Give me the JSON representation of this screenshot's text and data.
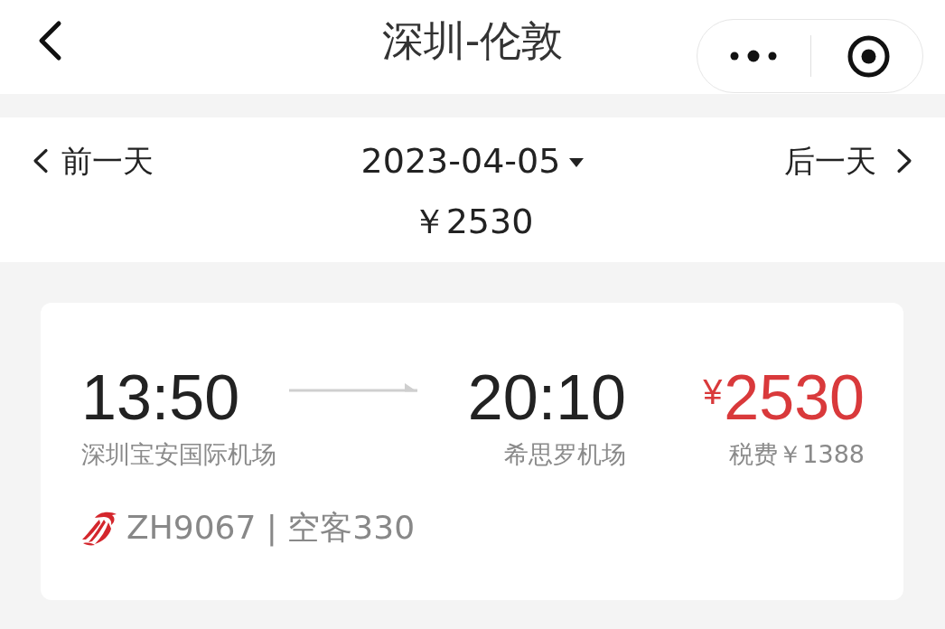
{
  "nav_bar": {
    "title": "深圳-伦敦"
  },
  "date_bar": {
    "previous_day": "前一天",
    "date": "2023-04-05",
    "next_day": "后一天",
    "lowest_price": "￥2530"
  },
  "flights": [
    {
      "departure_time": "13:50",
      "departure_airport": "深圳宝安国际机场",
      "arrival_time": "20:10",
      "arrival_airport": "希思罗机场",
      "price": "$^{¥}$2530",
      "tax": "税费￥1388",
      "flight_info": "ZH9067 | 空客330"
    }
  ]
}
